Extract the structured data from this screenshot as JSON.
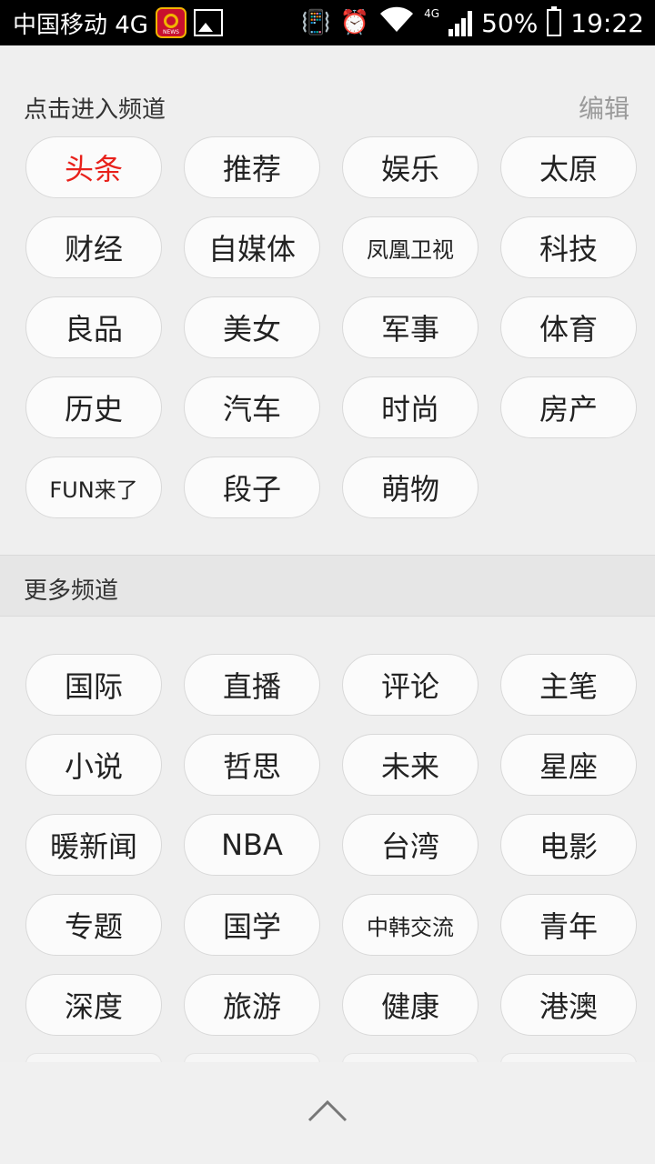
{
  "status_bar": {
    "carrier": "中国移动 4G",
    "network_badge": "4G",
    "battery": "50%",
    "time": "19:22"
  },
  "my_channels": {
    "title": "点击进入频道",
    "edit_label": "编辑",
    "items": [
      {
        "label": "头条",
        "active": true
      },
      {
        "label": "推荐"
      },
      {
        "label": "娱乐"
      },
      {
        "label": "太原"
      },
      {
        "label": "财经"
      },
      {
        "label": "自媒体"
      },
      {
        "label": "凤凰卫视",
        "small": true
      },
      {
        "label": "科技"
      },
      {
        "label": "良品"
      },
      {
        "label": "美女"
      },
      {
        "label": "军事"
      },
      {
        "label": "体育"
      },
      {
        "label": "历史"
      },
      {
        "label": "汽车"
      },
      {
        "label": "时尚"
      },
      {
        "label": "房产"
      },
      {
        "label": "FUN来了",
        "small": true
      },
      {
        "label": "段子"
      },
      {
        "label": "萌物"
      }
    ]
  },
  "more_channels": {
    "title": "更多频道",
    "items": [
      {
        "label": "国际"
      },
      {
        "label": "直播"
      },
      {
        "label": "评论"
      },
      {
        "label": "主笔"
      },
      {
        "label": "小说"
      },
      {
        "label": "哲思"
      },
      {
        "label": "未来"
      },
      {
        "label": "星座"
      },
      {
        "label": "暖新闻"
      },
      {
        "label": "NBA"
      },
      {
        "label": "台湾"
      },
      {
        "label": "电影"
      },
      {
        "label": "专题"
      },
      {
        "label": "国学"
      },
      {
        "label": "中韩交流",
        "small": true
      },
      {
        "label": "青年"
      },
      {
        "label": "深度"
      },
      {
        "label": "旅游"
      },
      {
        "label": "健康"
      },
      {
        "label": "港澳"
      }
    ]
  },
  "colors": {
    "active": "#e8211b",
    "background": "#efefef"
  },
  "icons": {
    "collapse": "chevron-up-icon"
  }
}
